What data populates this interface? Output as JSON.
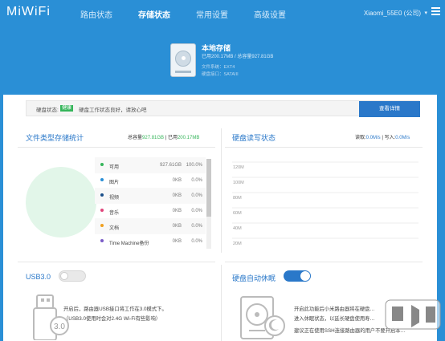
{
  "header": {
    "logo": "MiWiFi",
    "nav": [
      "路由状态",
      "存储状态",
      "常用设置",
      "高级设置"
    ],
    "router_name": "Xiaomi_55E0 (公司)"
  },
  "hero": {
    "title": "本地存储",
    "usage": "已用200.17MB / 总容量927.81GB",
    "filesystem": "文件系统：EXT4",
    "port": "硬盘接口：SATAIII"
  },
  "status": {
    "label": "硬盘状态:",
    "badge": "健康",
    "text": "硬盘工作状态良好，请放心吧",
    "button": "查看详情"
  },
  "file_stats": {
    "title": "文件类型存储统计",
    "total_label": "总容量",
    "total": "927.81GB",
    "sep": " | ",
    "used_label": "已用",
    "used": "200.17MB",
    "items": [
      {
        "name": "可用",
        "size": "927.61GB",
        "pct": "100.0%",
        "color": "#35b55a"
      },
      {
        "name": "图片",
        "size": "0KB",
        "pct": "0.0%",
        "color": "#2a8fd6"
      },
      {
        "name": "视频",
        "size": "0KB",
        "pct": "0.0%",
        "color": "#1a4f8a"
      },
      {
        "name": "音乐",
        "size": "0KB",
        "pct": "0.0%",
        "color": "#e0457b"
      },
      {
        "name": "文档",
        "size": "0KB",
        "pct": "0.0%",
        "color": "#f0a020"
      },
      {
        "name": "Time Machine备份",
        "size": "0KB",
        "pct": "0.0%",
        "color": "#7a5cc7"
      }
    ]
  },
  "rw": {
    "title": "硬盘读写状态",
    "read_label": "读取:",
    "read": "0.0M/s",
    "sep": " | ",
    "write_label": "写入:",
    "write": "0.0M/s"
  },
  "chart_data": {
    "type": "line",
    "yticks": [
      "120M",
      "100M",
      "80M",
      "60M",
      "40M",
      "20M"
    ],
    "series": [
      {
        "values": []
      }
    ]
  },
  "usb": {
    "title": "USB3.0",
    "line1": "开启后，路由器USB接口将工作在3.0模式下。",
    "line2": "（USB3.0使用时会对2.4G Wi-Fi有些影响）",
    "icon_label": "3.0"
  },
  "sleep": {
    "title": "硬盘自动休眠",
    "line1": "开启此功能后小米路由器将在硬盘…",
    "line2": "进入休眠状态，以延长硬盘使用寿…",
    "line3": "建议正在使用SSH连接路由器的用户不要开启本…"
  }
}
